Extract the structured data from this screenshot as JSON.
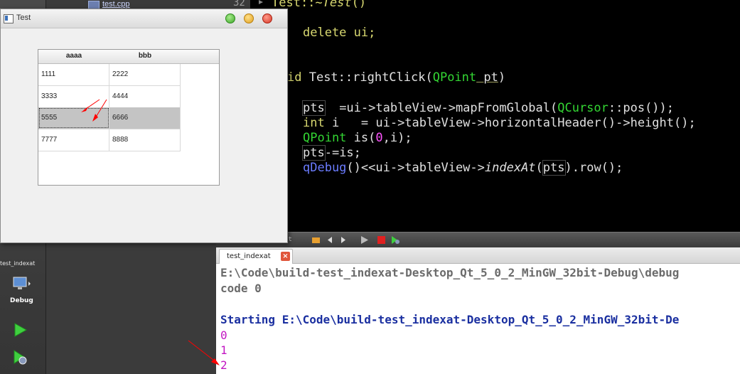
{
  "file_tab": {
    "name": "test.cpp"
  },
  "mode_bar": {
    "project": "test_indexat",
    "mode": "Debug"
  },
  "editor": {
    "line_number": "32",
    "lines": {
      "l1a": "Test::~",
      "l1b": "Test",
      "l1c": "()",
      "l2": "delete ui;",
      "l3a": "id ",
      "l3b": "Test::rightClick(",
      "l3c": "QPoint",
      "l3d": " pt",
      "l3e": ")",
      "l4a": "pts",
      "l4b": "  =ui->tableView->mapFromGlobal(",
      "l4c": "QCursor",
      "l4d": "::pos());",
      "l5a": "int",
      "l5b": " i   = ui->tableView->horizontalHeader()->height();",
      "l6a": "QPoint",
      "l6b": " is(",
      "l6c": "0",
      "l6d": ",i);",
      "l7a": "pts",
      "l7b": "-=is;",
      "l8a": "qDebug",
      "l8b": "()<<ui->tableView->",
      "l8c": "indexAt",
      "l8d": "(",
      "l8e": "pts",
      "l8f": ").row();"
    }
  },
  "output_toolbar": {
    "title": "ut"
  },
  "output": {
    "tab_label": "test_indexat",
    "lines": [
      "E:\\Code\\build-test_indexat-Desktop_Qt_5_0_2_MinGW_32bit-Debug\\debug",
      "code 0",
      "Starting E:\\Code\\build-test_indexat-Desktop_Qt_5_0_2_MinGW_32bit-De",
      "0",
      "1",
      "2"
    ]
  },
  "window": {
    "title": "Test",
    "table": {
      "headers": [
        "aaaa",
        "bbb"
      ],
      "rows": [
        [
          "1111",
          "2222"
        ],
        [
          "3333",
          "4444"
        ],
        [
          "5555",
          "6666"
        ],
        [
          "7777",
          "8888"
        ]
      ],
      "selected_row": 2
    }
  },
  "colors": {
    "editor_bg": "#000000",
    "arrow": "#ff0000",
    "selection": "#c4c4c4"
  }
}
